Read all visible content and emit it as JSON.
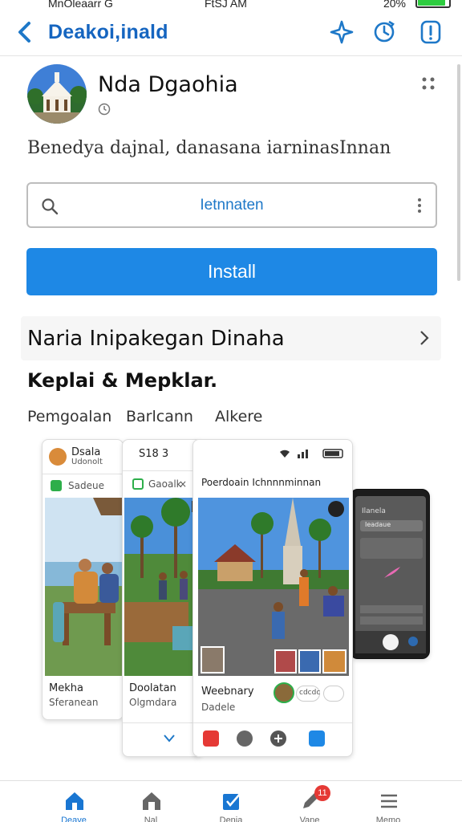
{
  "status_bar": {
    "carrier": "MnOleaarr G",
    "time": "FtSJ AM",
    "battery_text": "20%",
    "battery_level": 0.9
  },
  "header": {
    "title": "Deakoi,inald",
    "accent": "#1565c0"
  },
  "app": {
    "name": "Nda Dgaohia",
    "description": "Benedya dajnal, danasana iarninasInnan"
  },
  "search": {
    "value": "Ietnnaten"
  },
  "install": {
    "label": "Install",
    "color": "#1e88e5"
  },
  "section": {
    "title": "Naria Inipakegan Dinaha"
  },
  "subheading": "Keplai & Mepklar.",
  "tabs": [
    "Pemgoalan",
    "Barlcann",
    "Alkere"
  ],
  "gallery": {
    "card1": {
      "profile_name": "Dsala",
      "profile_sub": "Udonolt",
      "tag": "Sadeue",
      "caption": "Mekha",
      "caption_sub": "Sferanean"
    },
    "card2": {
      "time": "S18 3",
      "tag": "Gaoalk",
      "tag_close": "×",
      "caption": "Doolatan",
      "caption_sub": "Olgmdara"
    },
    "card3": {
      "title": "Poerdoain Ichnnnminnan",
      "caption": "Weebnary",
      "caption_sub": "Dadele",
      "chip": "cdcdc"
    },
    "card4": {
      "header": "Ilanela",
      "field": "Ieadaue"
    }
  },
  "bottom_nav": [
    {
      "label": "Deave",
      "icon": "home-icon"
    },
    {
      "label": "Nal",
      "icon": "house-outline-icon"
    },
    {
      "label": "Denia",
      "icon": "checkbox-icon"
    },
    {
      "label": "Vane",
      "icon": "edit-icon"
    },
    {
      "label": "Memo",
      "icon": "menu-icon"
    }
  ],
  "nav_badge": "11",
  "icons": [
    "back-arrow-icon",
    "compass-icon",
    "sync-icon",
    "info-icon",
    "clock-icon",
    "more-grid-icon",
    "search-icon",
    "chevron-right-icon"
  ]
}
